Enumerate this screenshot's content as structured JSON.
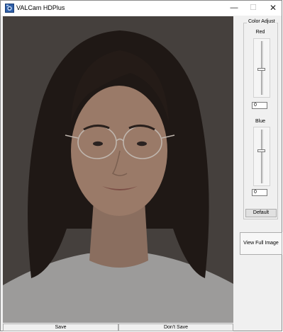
{
  "window": {
    "title": "VALCam HDPlus",
    "minimize_glyph": "—",
    "maximize_glyph": "☐",
    "close_glyph": "✕"
  },
  "image": {
    "subject": "portrait photo",
    "background_color": "#45403d"
  },
  "color_adjust": {
    "group_title": "Color Adjust",
    "red": {
      "label": "Red",
      "value": "0",
      "level": 0.5
    },
    "blue": {
      "label": "Blue",
      "value": "0",
      "level": 0.5
    },
    "default_label": "Default"
  },
  "buttons": {
    "view_full_image": "View Full Image",
    "save": "Save",
    "dont_save": "Don't Save"
  }
}
